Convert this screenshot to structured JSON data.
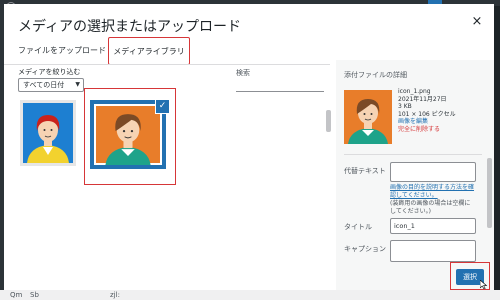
{
  "modal": {
    "title": "メディアの選択またはアップロード",
    "close_label": "×",
    "tabs": [
      {
        "label": "ファイルをアップロード"
      },
      {
        "label": "メディアライブラリ"
      }
    ]
  },
  "filters": {
    "label": "メディアを絞り込む",
    "date_selected": "すべての日付",
    "search_label": "検索",
    "search_value": ""
  },
  "attachments": [
    {
      "person": "red-hair-yellow-shirt",
      "background": "#1d7fd1",
      "selected": false
    },
    {
      "person": "brown-hair-teal-shirt",
      "background": "#e87d2a",
      "selected": true
    }
  ],
  "details": {
    "title": "添付ファイルの詳細",
    "filename": "icon_1.png",
    "date": "2021年11月27日",
    "size": "3 KB",
    "dimensions": "101 × 106 ピクセル",
    "edit_link": "画像を編集",
    "delete_link": "完全に削除する",
    "alt_label": "代替テキスト",
    "alt_value": "",
    "alt_help_link": "画像の目的を説明する方法を確認してください。",
    "alt_help_note": "(装飾用の画像の場合は空欄にしてください。)",
    "title_label": "タイトル",
    "title_value": "icon_1",
    "caption_label": "キャプション",
    "caption_value": ""
  },
  "footer": {
    "select_label": "選択"
  },
  "background_bar": [
    "Qm",
    "Sb",
    "zjl:"
  ],
  "colors": {
    "accent": "#2271b1",
    "highlight": "#d63638",
    "admin_bar": "#1d2327"
  }
}
